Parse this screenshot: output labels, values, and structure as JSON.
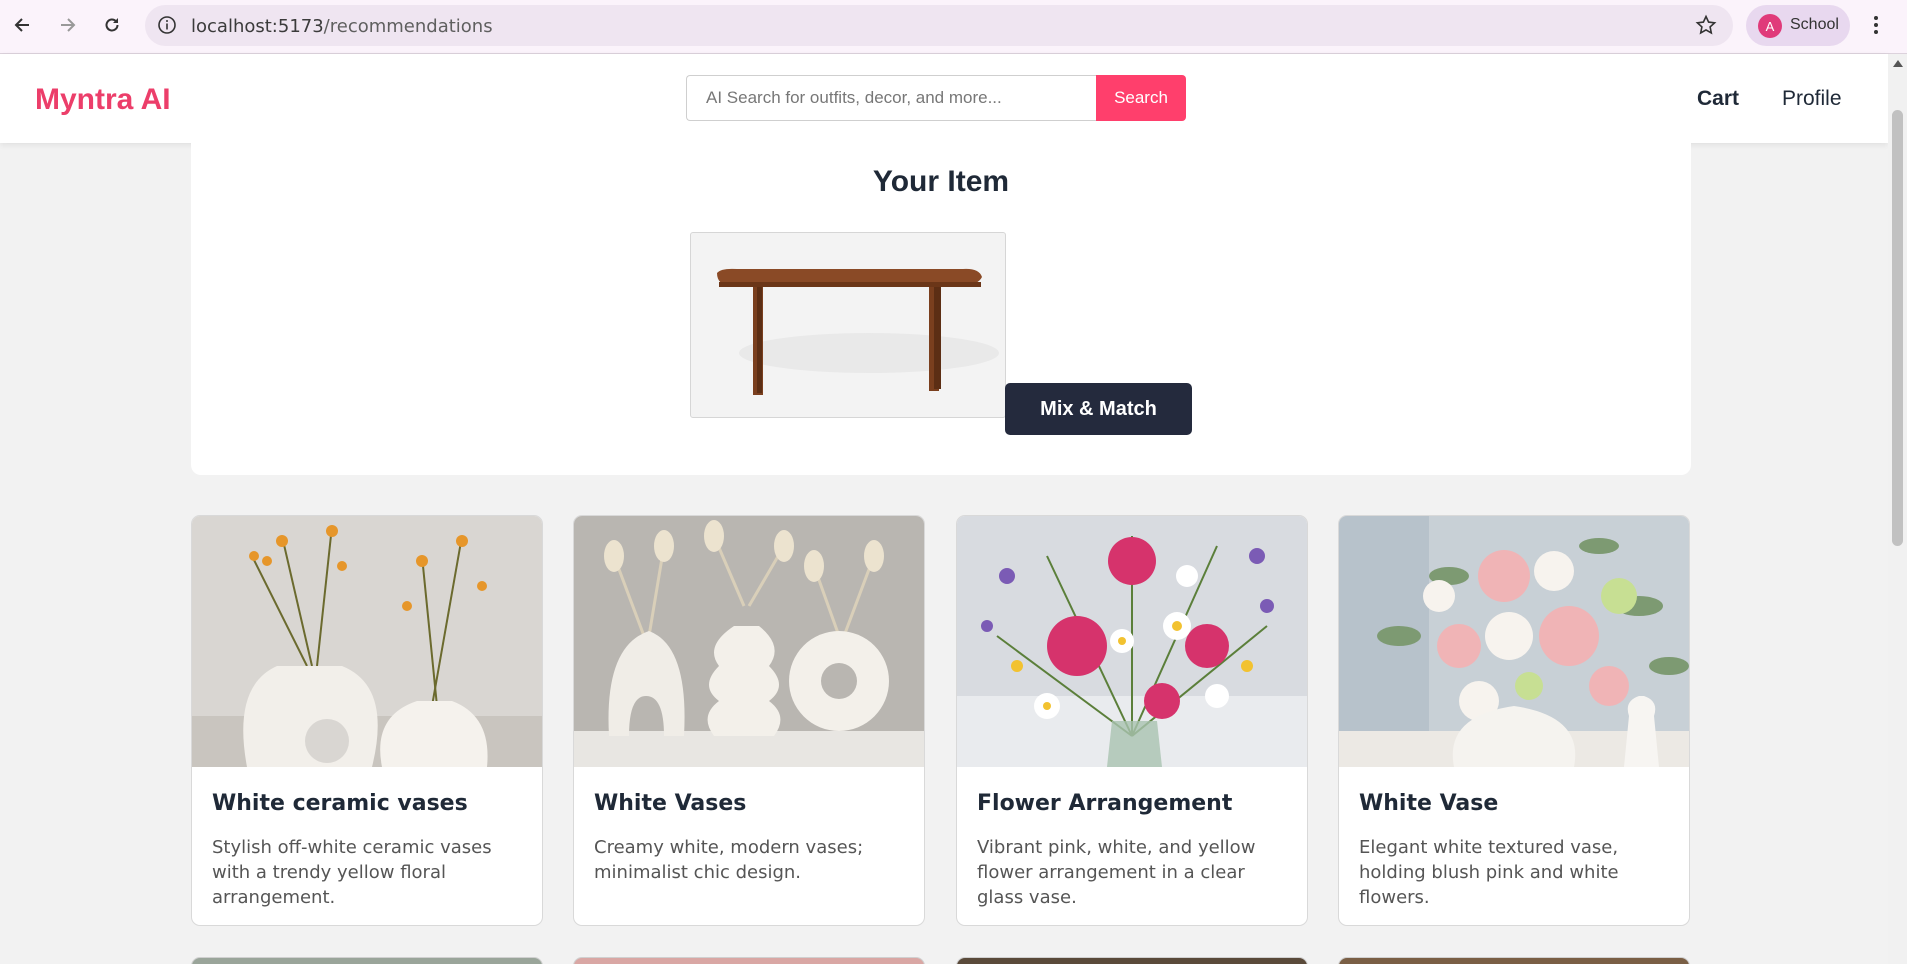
{
  "browser": {
    "url_host": "localhost:5173",
    "url_path": "/recommendations",
    "profile_initial": "A",
    "profile_name": "School"
  },
  "header": {
    "logo": "Myntra AI",
    "search_placeholder": "AI Search for outfits, decor, and more...",
    "search_button": "Search",
    "cart_label": "Cart",
    "profile_label": "Profile"
  },
  "item": {
    "title": "Your Item",
    "image_alt": "Wooden dining table",
    "mix_button": "Mix & Match"
  },
  "recommendations": [
    {
      "title": "White ceramic vases",
      "description": "Stylish off-white ceramic vases with a trendy yellow floral arrangement."
    },
    {
      "title": "White Vases",
      "description": "Creamy white, modern vases; minimalist chic design."
    },
    {
      "title": "Flower Arrangement",
      "description": "Vibrant pink, white, and yellow flower arrangement in a clear glass vase."
    },
    {
      "title": "White Vase",
      "description": "Elegant white textured vase, holding blush pink and white flowers."
    }
  ],
  "colors": {
    "brand": "#ec3e6a",
    "search_button": "#ff3f6c",
    "mix_button": "#242a3d"
  }
}
